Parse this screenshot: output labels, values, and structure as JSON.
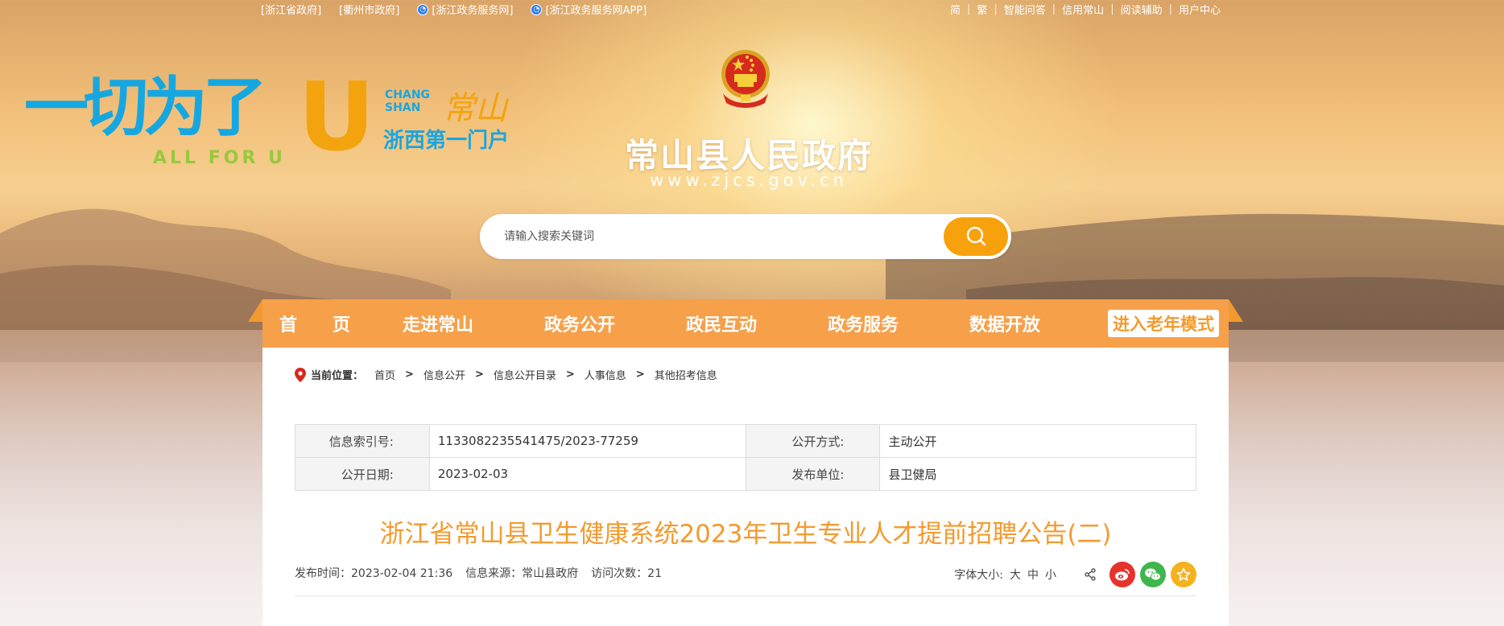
{
  "topbar": {
    "left_links": [
      "[浙江省政府]",
      "[衢州市政府]",
      "[浙江政务服务网]",
      "[浙江政务服务网APP]"
    ],
    "right_links": [
      "简",
      "繁",
      "智能问答",
      "信用常山",
      "阅读辅助",
      "用户中心"
    ]
  },
  "slogan": {
    "main": "一切为了",
    "u": "U",
    "sub": "ALL FOR U",
    "chang_shan_en": "CHANG SHAN",
    "chang_shan_cn": "常山",
    "gateway": "浙西第一门户"
  },
  "site": {
    "title": "常山县人民政府",
    "url": "www.zjcs.gov.cn"
  },
  "search": {
    "placeholder": "请输入搜索关键词"
  },
  "nav": {
    "items": [
      "首　　页",
      "走进常山",
      "政务公开",
      "政民互动",
      "政务服务",
      "数据开放"
    ],
    "elder_mode": "进入老年模式"
  },
  "breadcrumb": {
    "label": "当前位置：",
    "items": [
      "首页",
      "信息公开",
      "信息公开目录",
      "人事信息",
      "其他招考信息"
    ]
  },
  "meta": {
    "index_label": "信息索引号:",
    "index_value": "1133082235541475/2023-77259",
    "method_label": "公开方式:",
    "method_value": "主动公开",
    "date_label": "公开日期:",
    "date_value": "2023-02-03",
    "unit_label": "发布单位:",
    "unit_value": "县卫健局"
  },
  "article": {
    "title": "浙江省常山县卫生健康系统2023年卫生专业人才提前招聘公告(二)",
    "publish_time": "发布时间：2023-02-04 21:36",
    "source": "信息来源：常山县政府",
    "visits": "访问次数：21"
  },
  "tools": {
    "font_size_label": "字体大小:",
    "sizes": [
      "大",
      "中",
      "小"
    ]
  },
  "colors": {
    "nav_bg": "#f6a04a",
    "accent": "#f39a2e",
    "search_btn": "#f7a10c",
    "weibo": "#e6322a",
    "wechat": "#3fb64b",
    "favorite": "#f5b21e"
  }
}
